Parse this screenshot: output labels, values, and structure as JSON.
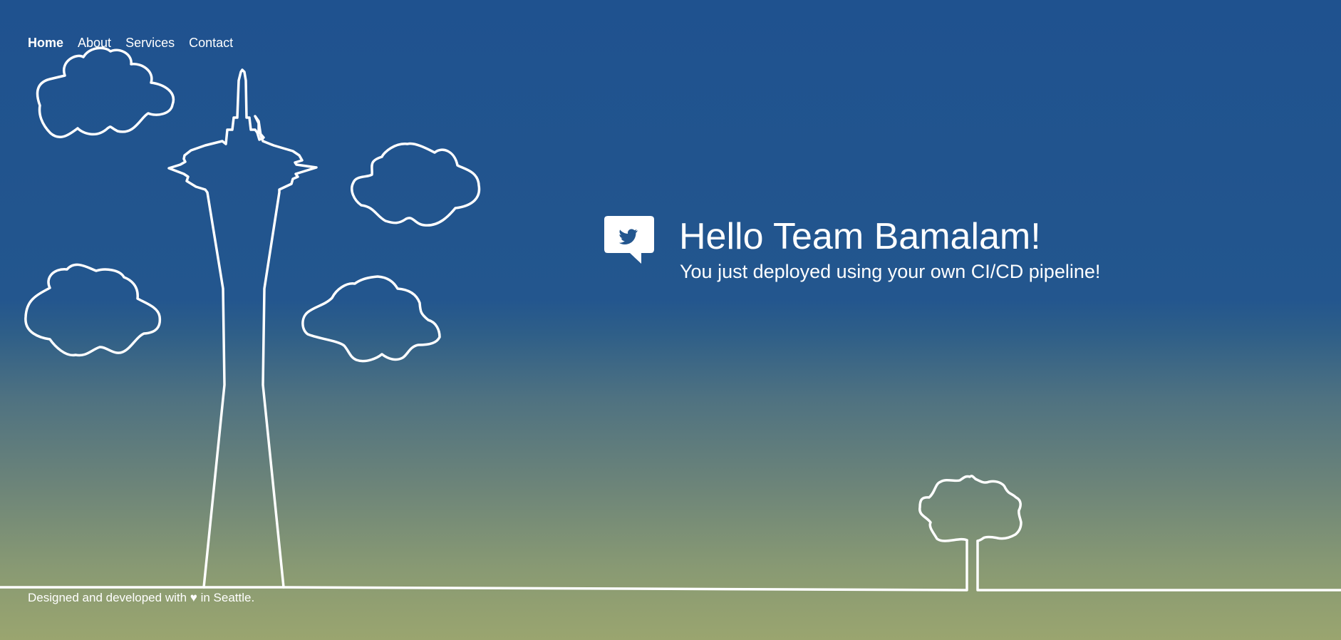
{
  "nav": {
    "items": [
      {
        "label": "Home",
        "active": true
      },
      {
        "label": "About",
        "active": false
      },
      {
        "label": "Services",
        "active": false
      },
      {
        "label": "Contact",
        "active": false
      }
    ]
  },
  "hero": {
    "title": "Hello Team Bamalam!",
    "subtitle": "You just deployed using your own CI/CD pipeline!",
    "icon": "twitter-bird-speech-bubble-icon"
  },
  "footer": {
    "text": "Designed and developed with ♥ in Seattle."
  },
  "scene": {
    "illustrations": [
      "space-needle",
      "cloud",
      "cloud",
      "cloud",
      "cloud",
      "tree",
      "ground-line"
    ]
  },
  "colors": {
    "sky_top": "#1f528f",
    "sky_bottom": "#9aa56f",
    "line": "#ffffff",
    "text": "#ffffff"
  }
}
